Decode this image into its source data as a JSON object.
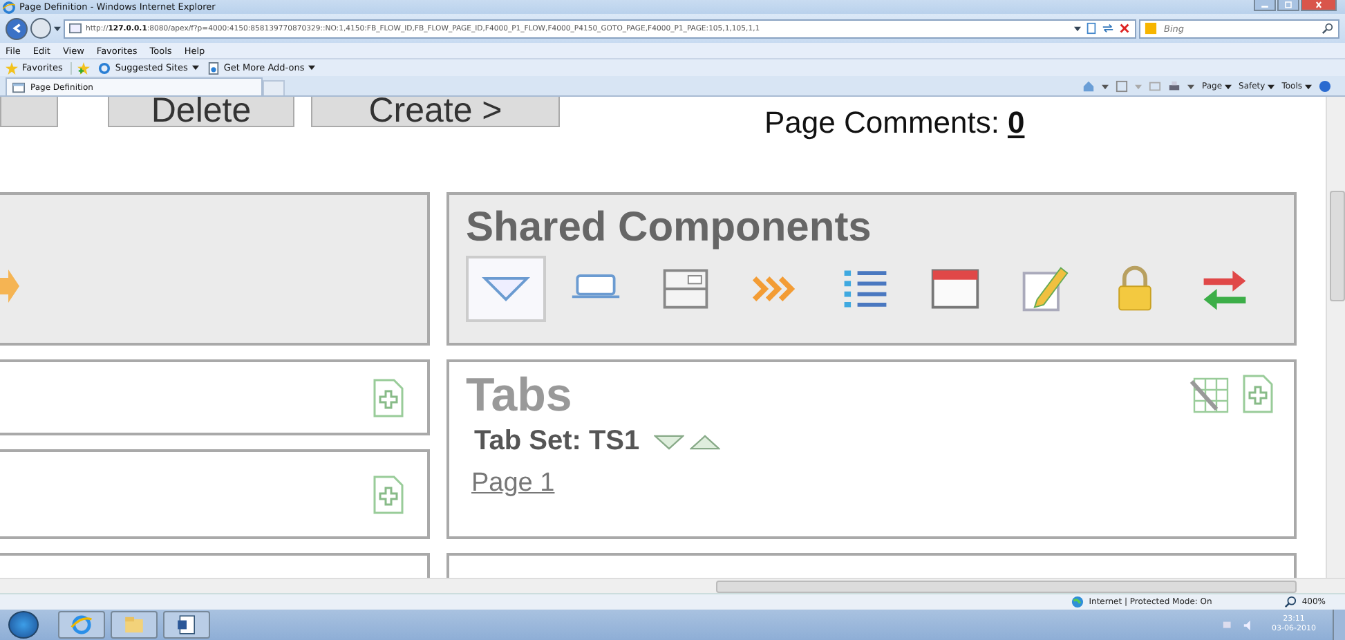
{
  "window": {
    "title": "Page Definition - Windows Internet Explorer"
  },
  "address_bar": {
    "url": "http://**127.0.0.1**:8080/apex/f?p=4000:4150:858139770870329::NO:1,4150:FB_FLOW_ID,FB_FLOW_PAGE_ID,F4000_P1_FLOW,F4000_P4150_GOTO_PAGE,F4000_P1_PAGE:105,1,105,1,1",
    "search_placeholder": "Bing"
  },
  "menu": [
    "File",
    "Edit",
    "View",
    "Favorites",
    "Tools",
    "Help"
  ],
  "favorites_bar": [
    {
      "label": "Favorites",
      "kind": "star",
      "dropdown": false
    },
    {
      "label": "Suggested Sites",
      "kind": "ie",
      "dropdown": true
    },
    {
      "label": "Get More Add-ons",
      "kind": "page",
      "dropdown": true
    }
  ],
  "tabs": [
    {
      "label": "Page Definition",
      "selected": true
    }
  ],
  "command_bar": [
    {
      "label": "Page"
    },
    {
      "label": "Safety"
    },
    {
      "label": "Tools"
    }
  ],
  "page": {
    "buttons": [
      "Delete",
      "Create >"
    ],
    "comments_label": "Page Comments:",
    "comments_count": "0",
    "shared_components": {
      "title": "Shared Components",
      "icons": [
        {
          "kind": "triangle",
          "selected": true
        },
        {
          "kind": "tab",
          "selected": false
        },
        {
          "kind": "window",
          "selected": false
        },
        {
          "kind": "chevrons",
          "selected": false
        },
        {
          "kind": "list",
          "selected": false
        },
        {
          "kind": "redwindow",
          "selected": false
        },
        {
          "kind": "pencil",
          "selected": false
        },
        {
          "kind": "lock",
          "selected": false
        },
        {
          "kind": "swap",
          "selected": false
        }
      ]
    },
    "tabs_panel": {
      "title": "Tabs",
      "tab_set": "Tab Set: TS1",
      "link": "Page 1"
    }
  },
  "status_bar": {
    "zone": "Internet | Protected Mode: On",
    "zoom": "400%"
  },
  "taskbar": {
    "time": "23:11",
    "date": "03-06-2010"
  }
}
